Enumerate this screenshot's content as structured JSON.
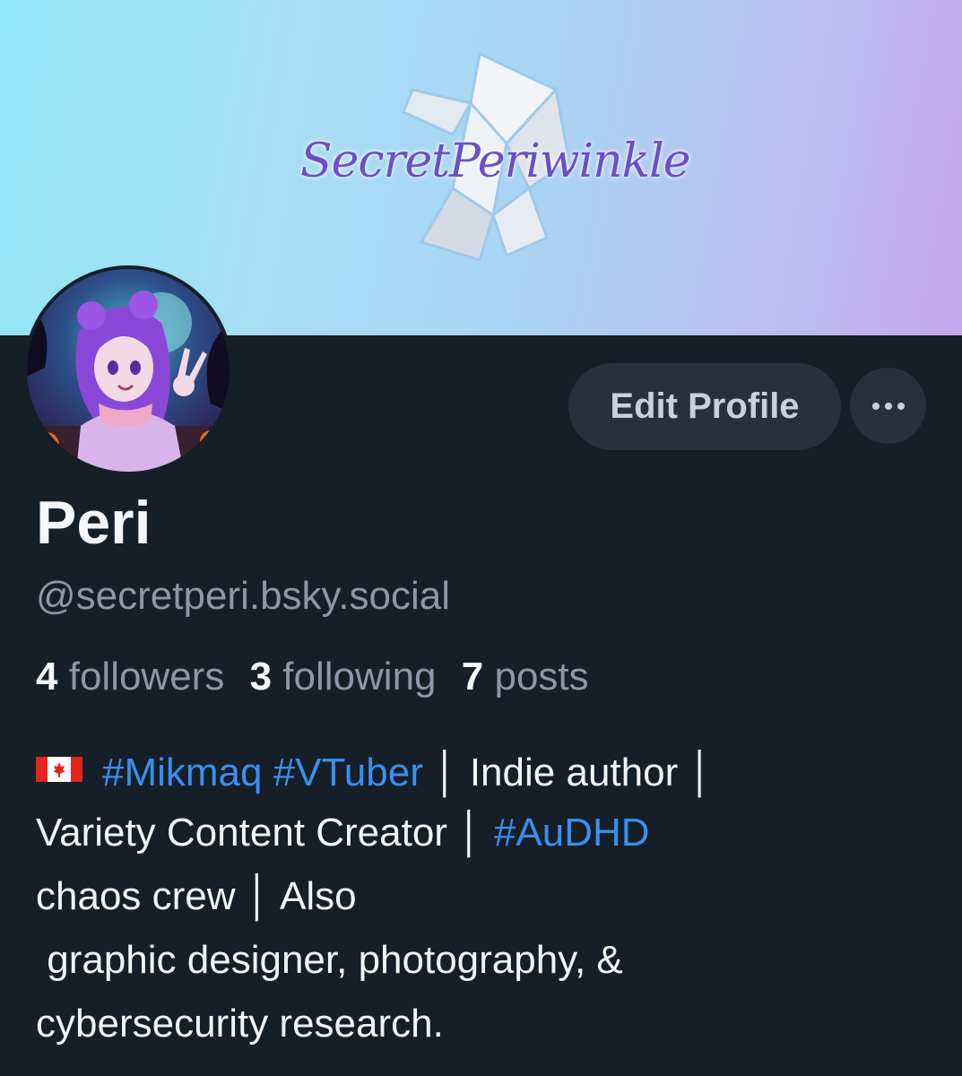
{
  "banner": {
    "logo_text": "SecretPeriwinkle"
  },
  "profile": {
    "display_name": "Peri",
    "handle": "@secretperi.bsky.social"
  },
  "actions": {
    "edit_label": "Edit Profile",
    "more_icon": "ellipsis-icon"
  },
  "stats": {
    "followers_count": "4",
    "followers_label": "followers",
    "following_count": "3",
    "following_label": "following",
    "posts_count": "7",
    "posts_label": "posts"
  },
  "bio": {
    "flag_icon": "canada-flag-icon",
    "tag_mikmaq": "#Mikmaq",
    "tag_vtuber": "#VTuber",
    "line1_text": "│ Indie author │",
    "line2_text": "Variety Content Creator │ ",
    "tag_audhd": "#AuDHD",
    "line3_text": "chaos crew │ Also",
    "line4_text": " graphic designer, photography, &",
    "line5_text": "cybersecurity research."
  },
  "colors": {
    "background": "#161e27",
    "hashtag": "#3a8ff0",
    "muted_text": "#8b98a8",
    "button_bg": "#26313e"
  }
}
